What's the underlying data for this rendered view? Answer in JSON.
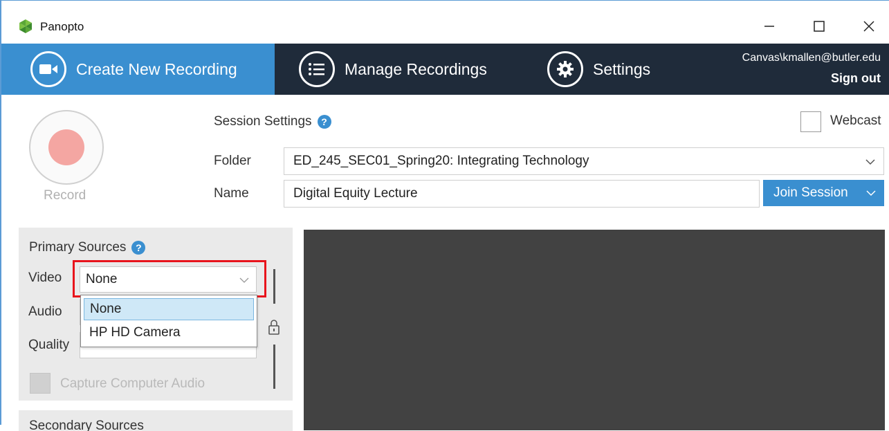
{
  "window": {
    "title": "Panopto",
    "controls": {
      "minimize": "—",
      "maximize": "☐",
      "close": "✕"
    }
  },
  "nav": {
    "tabs": [
      {
        "label": "Create New Recording",
        "icon": "video-camera-icon",
        "active": true
      },
      {
        "label": "Manage Recordings",
        "icon": "list-icon",
        "active": false
      },
      {
        "label": "Settings",
        "icon": "gear-icon",
        "active": false
      }
    ],
    "user": "Canvas\\kmallen@butler.edu",
    "sign_out": "Sign out"
  },
  "record": {
    "label": "Record"
  },
  "session": {
    "title": "Session Settings",
    "help": "?",
    "webcast_label": "Webcast",
    "webcast_checked": false,
    "folder_label": "Folder",
    "folder_value": "ED_245_SEC01_Spring20: Integrating Technology",
    "name_label": "Name",
    "name_value": "Digital Equity Lecture",
    "join_label": "Join Session"
  },
  "primary_sources": {
    "title": "Primary Sources",
    "help": "?",
    "video_label": "Video",
    "video_value": "None",
    "video_options": [
      "None",
      "HP HD Camera"
    ],
    "audio_label": "Audio",
    "quality_label": "Quality",
    "quality_value": "",
    "capture_audio_label": "Capture Computer Audio"
  },
  "secondary_sources": {
    "title": "Secondary Sources"
  },
  "colors": {
    "nav_bg": "#1f2b3a",
    "accent": "#3a8fd0",
    "highlight": "#e8141c",
    "preview_bg": "#424242"
  }
}
